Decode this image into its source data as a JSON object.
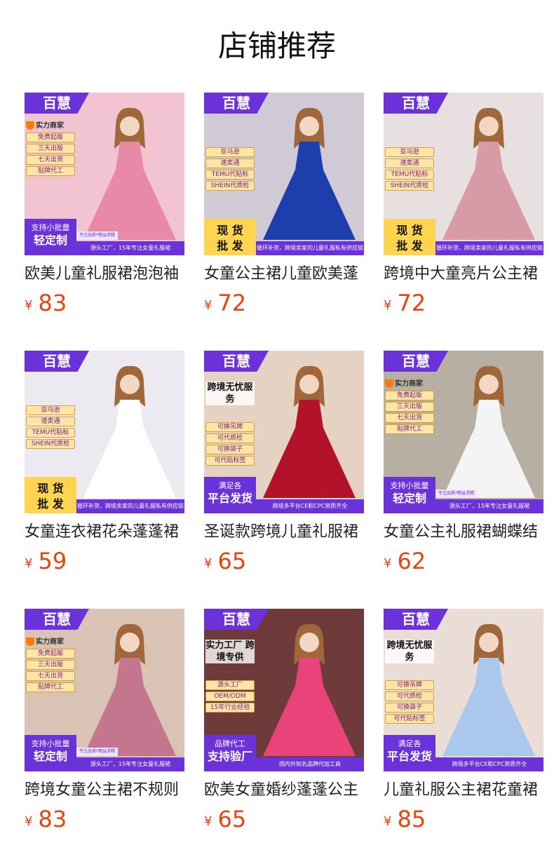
{
  "page": {
    "title": "店铺推荐"
  },
  "brand_logo": "百慧",
  "products": [
    {
      "name": "欧美儿童礼服裙泡泡袖",
      "price": "83",
      "currency": "¥",
      "image": {
        "seal": "实力商家",
        "tags": [
          "免费起版",
          "三天出版",
          "七天出货",
          "贴牌代工"
        ],
        "promo_small": "支持小批量",
        "promo_large": "轻定制",
        "footer_top": "专注品质*精益求精",
        "footer": "源头工厂，15年专注女童礼服裙",
        "promo_style": "purple",
        "bg": "#f2c4d2",
        "accent": "#e88aa7"
      }
    },
    {
      "name": "女童公主裙儿童欧美蓬",
      "price": "72",
      "currency": "¥",
      "image": {
        "tags": [
          "亚马逊",
          "速卖通",
          "TEMU代贴标",
          "SHEIN代质检"
        ],
        "promo_small": "现 货",
        "promo_large": "批 发",
        "footer": "循环补货，跨境卖家的儿童礼服私有供应链",
        "promo_style": "yellow",
        "bg": "#cfcad6",
        "accent": "#1d3fae"
      }
    },
    {
      "name": "跨境中大童亮片公主裙",
      "price": "72",
      "currency": "¥",
      "image": {
        "tags": [
          "亚马逊",
          "速卖通",
          "TEMU代贴标",
          "SHEIN代质检"
        ],
        "promo_small": "现 货",
        "promo_large": "批 发",
        "footer": "循环补货，跨境卖家的儿童礼服私有供应链",
        "promo_style": "yellow",
        "bg": "#e8e0e0",
        "accent": "#d99aa8"
      }
    },
    {
      "name": "女童连衣裙花朵蓬蓬裙",
      "price": "59",
      "currency": "¥",
      "image": {
        "tags": [
          "亚马逊",
          "速卖通",
          "TEMU代贴标",
          "SHEIN代质检"
        ],
        "promo_small": "现 货",
        "promo_large": "批 发",
        "footer": "循环补货，跨境卖家的儿童礼服私有供应链",
        "promo_style": "yellow",
        "bg": "#eceaf0",
        "accent": "#ffffff"
      }
    },
    {
      "name": "圣诞款跨境儿童礼服裙",
      "price": "65",
      "currency": "¥",
      "image": {
        "headline": "跨境无忧服务",
        "tags": [
          "可换吊牌",
          "可代质检",
          "可换袋子",
          "可代贴标签"
        ],
        "promo_small": "满足各",
        "promo_large": "平台发货",
        "footer": "跨境多平台CE和CPC资质齐全",
        "promo_style": "purple",
        "bg": "#e6d2c2",
        "accent": "#b3122a"
      }
    },
    {
      "name": "女童公主礼服裙蝴蝶结",
      "price": "62",
      "currency": "¥",
      "image": {
        "seal": "实力商家",
        "tags": [
          "免费起版",
          "三天出版",
          "七天出货",
          "贴牌代工"
        ],
        "promo_small": "支持小批量",
        "promo_large": "轻定制",
        "footer_top": "专注品质*精益求精",
        "footer": "源头工厂，15年专注女童礼服裙",
        "promo_style": "purple",
        "bg": "#b7b0a2",
        "accent": "#f4f4f4"
      }
    },
    {
      "name": "跨境女童公主裙不规则",
      "price": "83",
      "currency": "¥",
      "image": {
        "seal": "实力商家",
        "tags": [
          "免费起版",
          "三天出版",
          "七天出货",
          "贴牌代工"
        ],
        "promo_small": "支持小批量",
        "promo_large": "轻定制",
        "footer_top": "专注品质*精益求精",
        "footer": "源头工厂，15年专注女童礼服裙",
        "promo_style": "purple",
        "bg": "#d9c3b4",
        "accent": "#c5768f"
      }
    },
    {
      "name": "欧美女童婚纱蓬蓬公主",
      "price": "65",
      "currency": "¥",
      "image": {
        "headline": "实力工厂 跨境专供",
        "tags": [
          "源头工厂",
          "OEM/ODM",
          "15年行业经验"
        ],
        "promo_small": "品牌代工",
        "promo_large": "支持验厂",
        "footer": "国内外知名品牌代加工商",
        "promo_style": "purple",
        "bg": "#6f3a3a",
        "accent": "#e8447a"
      }
    },
    {
      "name": "儿童礼服公主裙花童裙",
      "price": "85",
      "currency": "¥",
      "image": {
        "headline": "跨境无忧服务",
        "tags": [
          "可换吊牌",
          "可代质检",
          "可换袋子",
          "可代贴标签"
        ],
        "promo_small": "满足各",
        "promo_large": "平台发货",
        "footer": "跨境多平台CE和CPC资质齐全",
        "promo_style": "purple",
        "bg": "#e9ddd6",
        "accent": "#a9c8ec"
      }
    }
  ]
}
